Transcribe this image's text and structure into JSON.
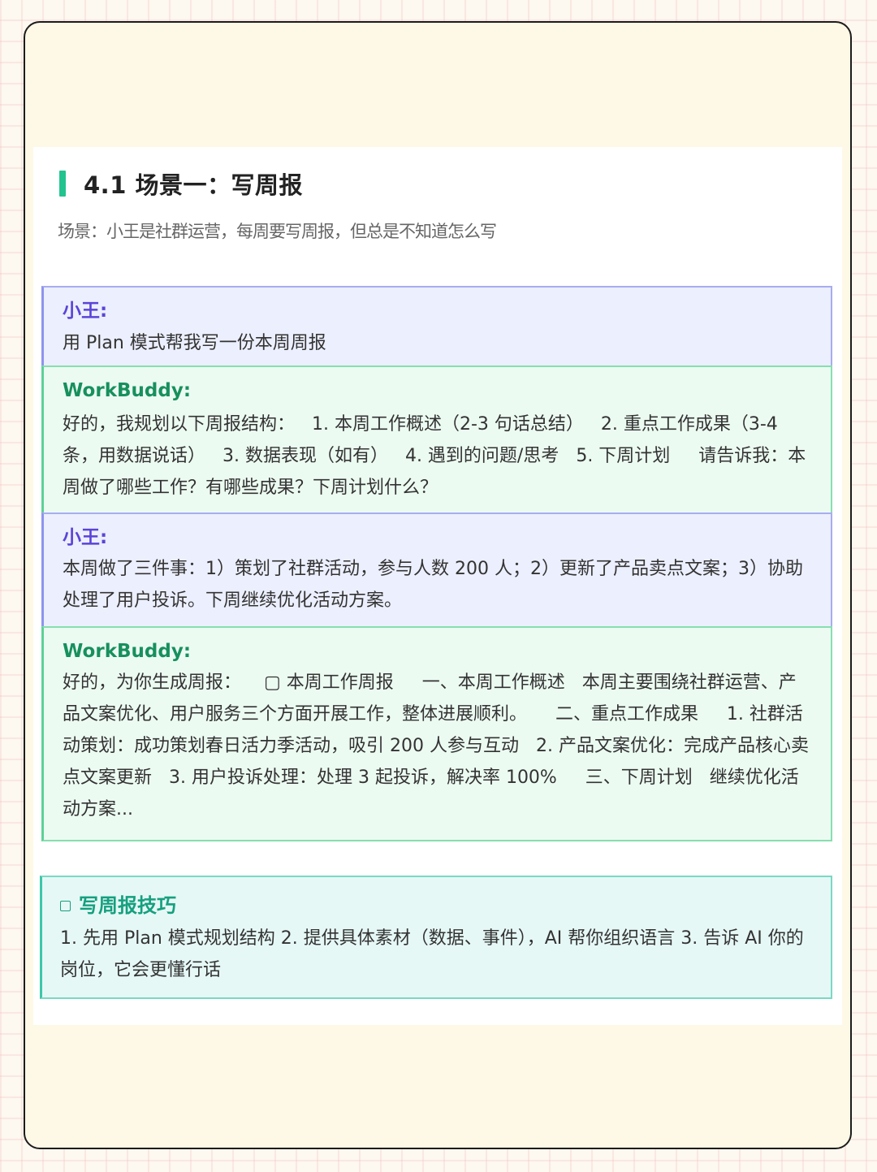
{
  "section": {
    "title": "4.1 场景一：写周报",
    "subtitle": "场景：小王是社群运营，每周要写周报，但总是不知道怎么写"
  },
  "conversation": [
    {
      "speaker": "小王:",
      "role": "user",
      "text": "用 Plan 模式帮我写一份本周周报"
    },
    {
      "speaker": "WorkBuddy:",
      "role": "bot",
      "text": "好的，我规划以下周报结构：   1. 本周工作概述（2-3 句话总结）   2. 重点工作成果（3-4 条，用数据说话）   3. 数据表现（如有）   4. 遇到的问题/思考   5. 下周计划     请告诉我：本周做了哪些工作？有哪些成果？下周计划什么？"
    },
    {
      "speaker": "小王:",
      "role": "user",
      "text": "本周做了三件事：1）策划了社群活动，参与人数 200 人；2）更新了产品卖点文案；3）协助处理了用户投诉。下周继续优化活动方案。"
    },
    {
      "speaker": "WorkBuddy:",
      "role": "bot",
      "text": "好的，为你生成周报：    ▢ 本周工作周报     一、本周工作概述   本周主要围绕社群运营、产品文案优化、用户服务三个方面开展工作，整体进展顺利。     二、重点工作成果     1. 社群活动策划：成功策划春日活力季活动，吸引 200 人参与互动   2. 产品文案优化：完成产品核心卖点文案更新   3. 用户投诉处理：处理 3 起投诉，解决率 100%     三、下周计划   继续优化活动方案..."
    }
  ],
  "tips": {
    "title": "写周报技巧",
    "icon": "square-icon",
    "text": "1. 先用 Plan 模式规划结构   2. 提供具体素材（数据、事件），AI 帮你组织语言   3. 告诉 AI 你的岗位，它会更懂行话"
  },
  "colors": {
    "accent": "#22c38e",
    "user_label": "#5a44d8",
    "bot_label": "#17905d",
    "tip_label": "#15a07e"
  }
}
